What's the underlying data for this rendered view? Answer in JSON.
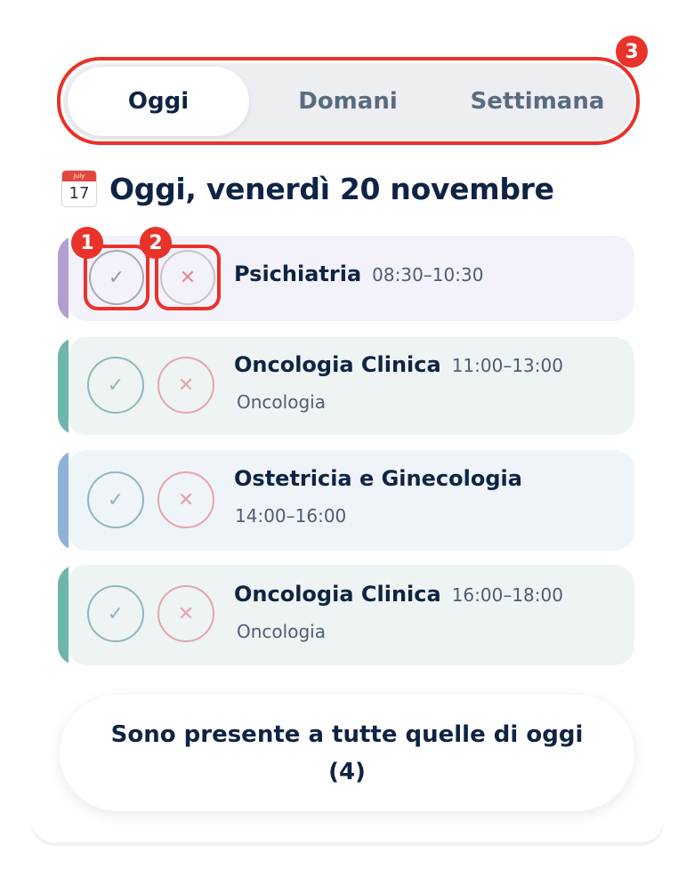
{
  "tabs": [
    {
      "label": "Oggi",
      "active": true
    },
    {
      "label": "Domani",
      "active": false
    },
    {
      "label": "Settimana",
      "active": false
    }
  ],
  "heading": {
    "calendar_icon": "calendar-icon",
    "calendar_month": "July",
    "calendar_day": "17",
    "text": "Oggi, venerdì 20 novembre"
  },
  "shifts": [
    {
      "title": "Psichiatria",
      "time": "08:30–10:30",
      "subtitle": "",
      "accent": "#b09fd0",
      "background": "#f3f2fa"
    },
    {
      "title": "Oncologia Clinica",
      "time": "11:00–13:00",
      "subtitle": "Oncologia",
      "accent": "#6fb5ad",
      "background": "#edf4f3"
    },
    {
      "title": "Ostetricia e Ginecologia",
      "time": "14:00–16:00",
      "subtitle": "",
      "accent": "#8eb1d8",
      "background": "#eff4f9"
    },
    {
      "title": "Oncologia Clinica",
      "time": "16:00–18:00",
      "subtitle": "Oncologia",
      "accent": "#6fb5ad",
      "background": "#edf4f3"
    }
  ],
  "icons": {
    "confirm": "✓",
    "decline": "✕"
  },
  "annotations": [
    "1",
    "2",
    "3"
  ],
  "bottom_button": {
    "line1": "Sono presente a tutte quelle di oggi",
    "line2": "(4)"
  },
  "colors": {
    "annotation": "#e8322a",
    "text": "#0f2444"
  }
}
